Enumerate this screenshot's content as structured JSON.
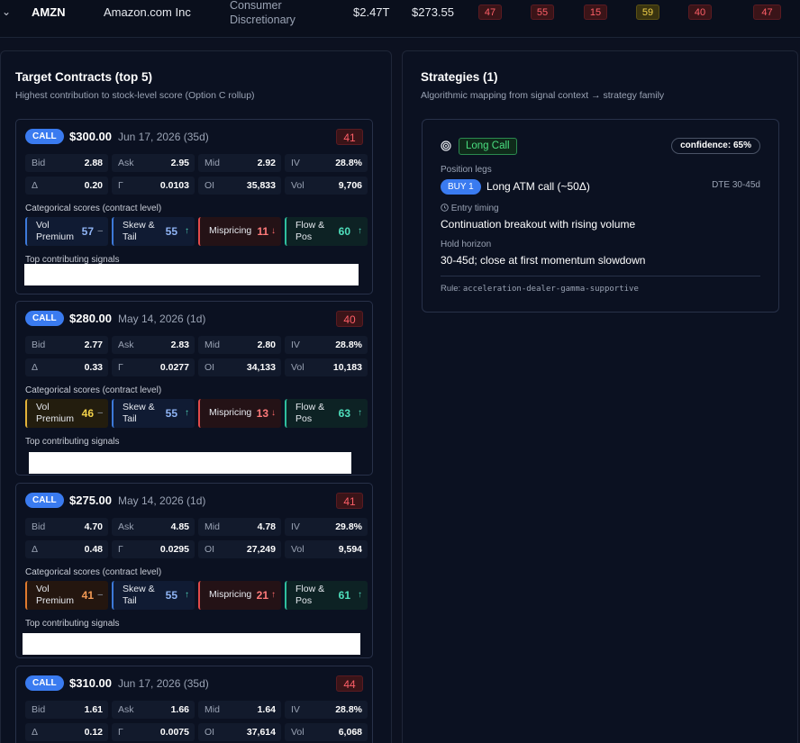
{
  "top_row": {
    "ticker": "AMZN",
    "company": "Amazon.com Inc",
    "sector_line1": "Consumer",
    "sector_line2": "Discretionary",
    "market_cap": "$2.47T",
    "price": "$273.55",
    "scores": [
      "47",
      "55",
      "15",
      "59",
      "40",
      "47"
    ]
  },
  "targets": {
    "title": "Target Contracts (top 5)",
    "subtitle": "Highest contribution to stock-level score (Option C rollup)",
    "categorical_label": "Categorical scores (contract level)",
    "signals_label": "Top contributing signals",
    "metric_labels": {
      "bid": "Bid",
      "ask": "Ask",
      "mid": "Mid",
      "iv": "IV",
      "delta": "Δ",
      "gamma": "Γ",
      "oi": "OI",
      "vol": "Vol"
    },
    "category_labels": {
      "vol_premium_1": "Vol",
      "vol_premium_2": "Premium",
      "skew_1": "Skew &",
      "skew_2": "Tail",
      "mispricing": "Mispricing",
      "flow_1": "Flow &",
      "flow_2": "Pos"
    },
    "contracts": [
      {
        "type": "CALL",
        "strike": "$300.00",
        "expiry": "Jun 17, 2026 (35d)",
        "score": "41",
        "bid": "2.88",
        "ask": "2.95",
        "mid": "2.92",
        "iv": "28.8%",
        "delta": "0.20",
        "gamma": "0.0103",
        "oi": "35,833",
        "vol": "9,706",
        "vol_premium": "57",
        "vol_premium_arrow": "–",
        "skew": "55",
        "skew_arrow": "↑",
        "mispricing": "11",
        "mispricing_arrow": "↓",
        "flow": "60",
        "flow_arrow": "↑"
      },
      {
        "type": "CALL",
        "strike": "$280.00",
        "expiry": "May 14, 2026 (1d)",
        "score": "40",
        "bid": "2.77",
        "ask": "2.83",
        "mid": "2.80",
        "iv": "28.8%",
        "delta": "0.33",
        "gamma": "0.0277",
        "oi": "34,133",
        "vol": "10,183",
        "vol_premium": "46",
        "vol_premium_arrow": "–",
        "skew": "55",
        "skew_arrow": "↑",
        "mispricing": "13",
        "mispricing_arrow": "↓",
        "flow": "63",
        "flow_arrow": "↑"
      },
      {
        "type": "CALL",
        "strike": "$275.00",
        "expiry": "May 14, 2026 (1d)",
        "score": "41",
        "bid": "4.70",
        "ask": "4.85",
        "mid": "4.78",
        "iv": "29.8%",
        "delta": "0.48",
        "gamma": "0.0295",
        "oi": "27,249",
        "vol": "9,594",
        "vol_premium": "41",
        "vol_premium_arrow": "–",
        "skew": "55",
        "skew_arrow": "↑",
        "mispricing": "21",
        "mispricing_arrow": "↑",
        "flow": "61",
        "flow_arrow": "↑"
      },
      {
        "type": "CALL",
        "strike": "$310.00",
        "expiry": "Jun 17, 2026 (35d)",
        "score": "44",
        "bid": "1.61",
        "ask": "1.66",
        "mid": "1.64",
        "iv": "28.8%",
        "delta": "0.12",
        "gamma": "0.0075",
        "oi": "37,614",
        "vol": "6,068"
      }
    ]
  },
  "strategies": {
    "title": "Strategies (1)",
    "subtitle": "Algorithmic mapping from signal context → strategy family",
    "strategy_name": "Long Call",
    "confidence": "confidence: 65%",
    "position_legs_label": "Position legs",
    "leg_badge": "BUY 1",
    "leg_text": "Long ATM call (~50Δ)",
    "dte": "DTE 30-45d",
    "entry_timing_label": "Entry timing",
    "entry_timing": "Continuation breakout with rising volume",
    "hold_horizon_label": "Hold horizon",
    "hold_horizon": "30-45d; close at first momentum slowdown",
    "rule_label": "Rule:",
    "rule_value": "acceleration-dealer-gamma-supportive"
  },
  "icons": {
    "row_toggle": "chevron-down-icon",
    "strategy": "target-icon",
    "timing": "clock-icon"
  }
}
